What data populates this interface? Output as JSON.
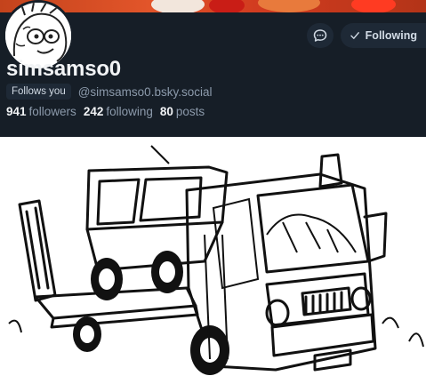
{
  "profile": {
    "display_name": "simsamso0",
    "follows_you_label": "Follows you",
    "handle": "@simsamso0.bsky.social",
    "following_button_label": "Following"
  },
  "stats": {
    "followers_count": "941",
    "followers_label": "followers",
    "following_count": "242",
    "following_label": "following",
    "posts_count": "80",
    "posts_label": "posts"
  },
  "colors": {
    "header_bg": "#161e27",
    "button_bg": "#1e2936",
    "text_primary": "#f1f3f5",
    "text_muted": "#8c9aab"
  },
  "icons": {
    "message": "message-icon",
    "following_check": "check-icon"
  }
}
